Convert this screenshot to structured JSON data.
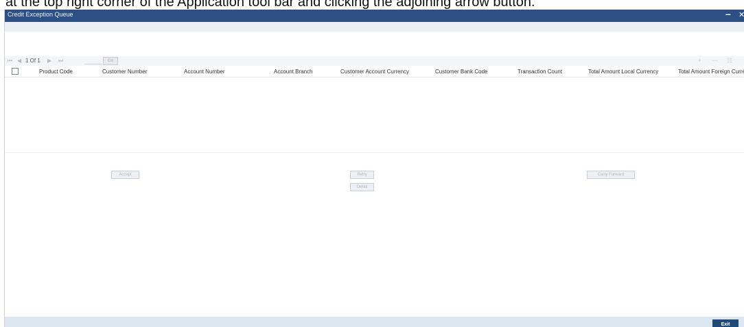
{
  "doc_text": "at the top right corner of the Application tool bar and clicking the adjoining arrow button.",
  "window": {
    "title": "Credit Exception Queue",
    "minimize_glyph": "–",
    "close_glyph": "✕"
  },
  "pager": {
    "first_icon": "first-page-icon",
    "prev_icon": "previous-page-icon",
    "page_info": "1 Of 1",
    "next_icon": "next-page-icon",
    "last_icon": "last-page-icon",
    "go_label": "Go",
    "tools": [
      "+",
      "—",
      "☷"
    ]
  },
  "grid": {
    "columns": [
      "Product Code",
      "Customer Number",
      "Account Number",
      "Account Branch",
      "Customer Account Currency",
      "Customer Bank Code",
      "Transaction Count",
      "Total Amount Local Currency",
      "Total Amount Foreign Currency"
    ],
    "rows": []
  },
  "actions": {
    "accept": "Accept",
    "retry": "Retry",
    "detail": "Detail",
    "carry_forward": "Carry Forward"
  },
  "footer": {
    "exit": "Exit"
  },
  "colors": {
    "titlebar": "#2c4f84",
    "footer": "#dbe6f1",
    "exit_button": "#1f4a7a"
  }
}
